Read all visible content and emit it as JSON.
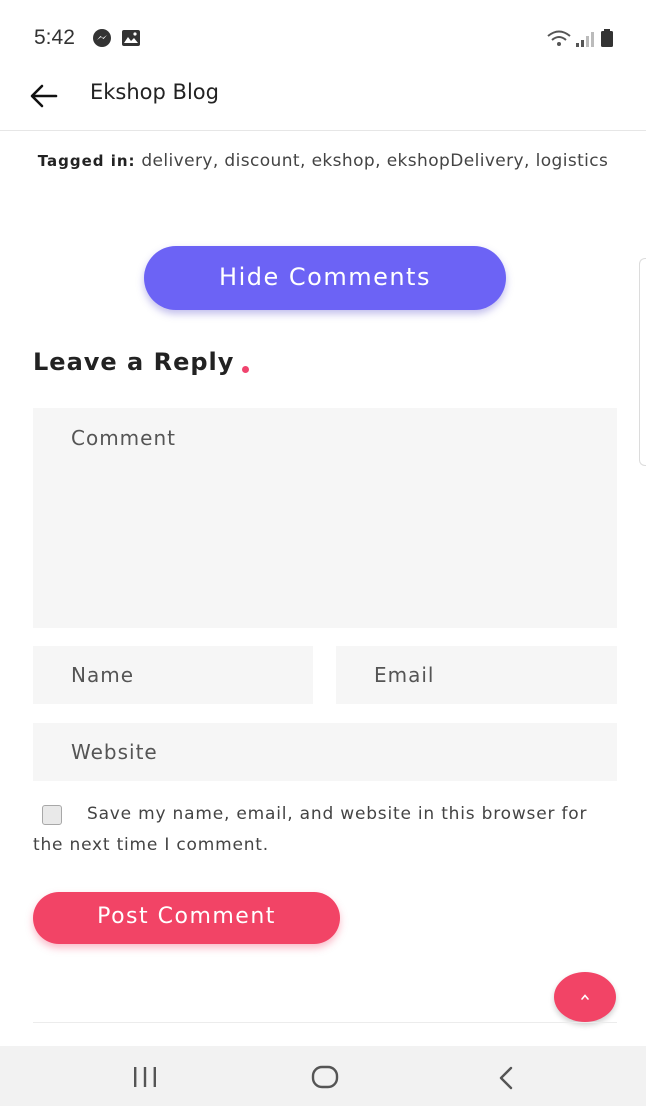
{
  "status_bar": {
    "time": "5:42",
    "icons": [
      "messenger-icon",
      "image-icon",
      "wifi-icon",
      "signal-icon",
      "battery-icon"
    ]
  },
  "app_bar": {
    "title": "Ekshop Blog",
    "back_icon": "arrow-left-icon"
  },
  "tags": {
    "label": "Tagged in:",
    "values": " delivery, discount, ekshop, ekshopDelivery, logistics"
  },
  "hide_comments_label": "Hide Comments",
  "reply": {
    "heading": "Leave a Reply",
    "comment_placeholder": "Comment",
    "name_placeholder": "Name",
    "email_placeholder": "Email",
    "website_placeholder": "Website",
    "consent_text": "Save my name, email, and website in this browser for the next time I comment.",
    "consent_checked": false,
    "submit_label": "Post Comment"
  },
  "colors": {
    "primary_button": "#6c63f5",
    "accent": "#f24466"
  },
  "nav_bar": {
    "icons": [
      "recent-apps-icon",
      "home-icon",
      "back-icon"
    ]
  }
}
